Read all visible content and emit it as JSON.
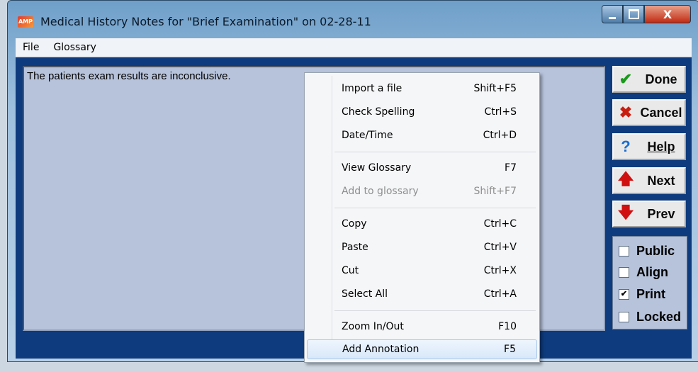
{
  "window": {
    "title": "Medical History Notes for \"Brief Examination\" on 02-28-11",
    "close_glyph": "X"
  },
  "menubar": {
    "items": [
      "File",
      "Glossary"
    ]
  },
  "notes": {
    "text": "The patients exam results are inconclusive."
  },
  "buttons": {
    "done": "Done",
    "cancel": "Cancel",
    "help": "Help",
    "next": "Next",
    "prev": "Prev"
  },
  "checkboxes": [
    {
      "label": "Public",
      "checked": false
    },
    {
      "label": "Align",
      "checked": false
    },
    {
      "label": "Print",
      "checked": true
    },
    {
      "label": "Locked",
      "checked": false
    }
  ],
  "context_menu": {
    "items": [
      {
        "label": "Import a file",
        "shortcut": "Shift+F5"
      },
      {
        "label": "Check Spelling",
        "shortcut": "Ctrl+S"
      },
      {
        "label": "Date/Time",
        "shortcut": "Ctrl+D"
      },
      {
        "label": "View Glossary",
        "shortcut": "F7"
      },
      {
        "label": "Add to glossary",
        "shortcut": "Shift+F7",
        "disabled": true
      },
      {
        "label": "Copy",
        "shortcut": "Ctrl+C"
      },
      {
        "label": "Paste",
        "shortcut": "Ctrl+V"
      },
      {
        "label": "Cut",
        "shortcut": "Ctrl+X"
      },
      {
        "label": "Select All",
        "shortcut": "Ctrl+A"
      },
      {
        "label": "Zoom In/Out",
        "shortcut": "F10"
      },
      {
        "label": "Add Annotation",
        "shortcut": "F5",
        "highlighted": true
      }
    ]
  },
  "colors": {
    "client_bg": "#0e3b7d",
    "notes_bg": "#b7c3db",
    "done_check": "#1a9a1a",
    "cancel_x": "#c81e10",
    "help_q": "#1a6ed0",
    "arrow": "#d01010"
  }
}
